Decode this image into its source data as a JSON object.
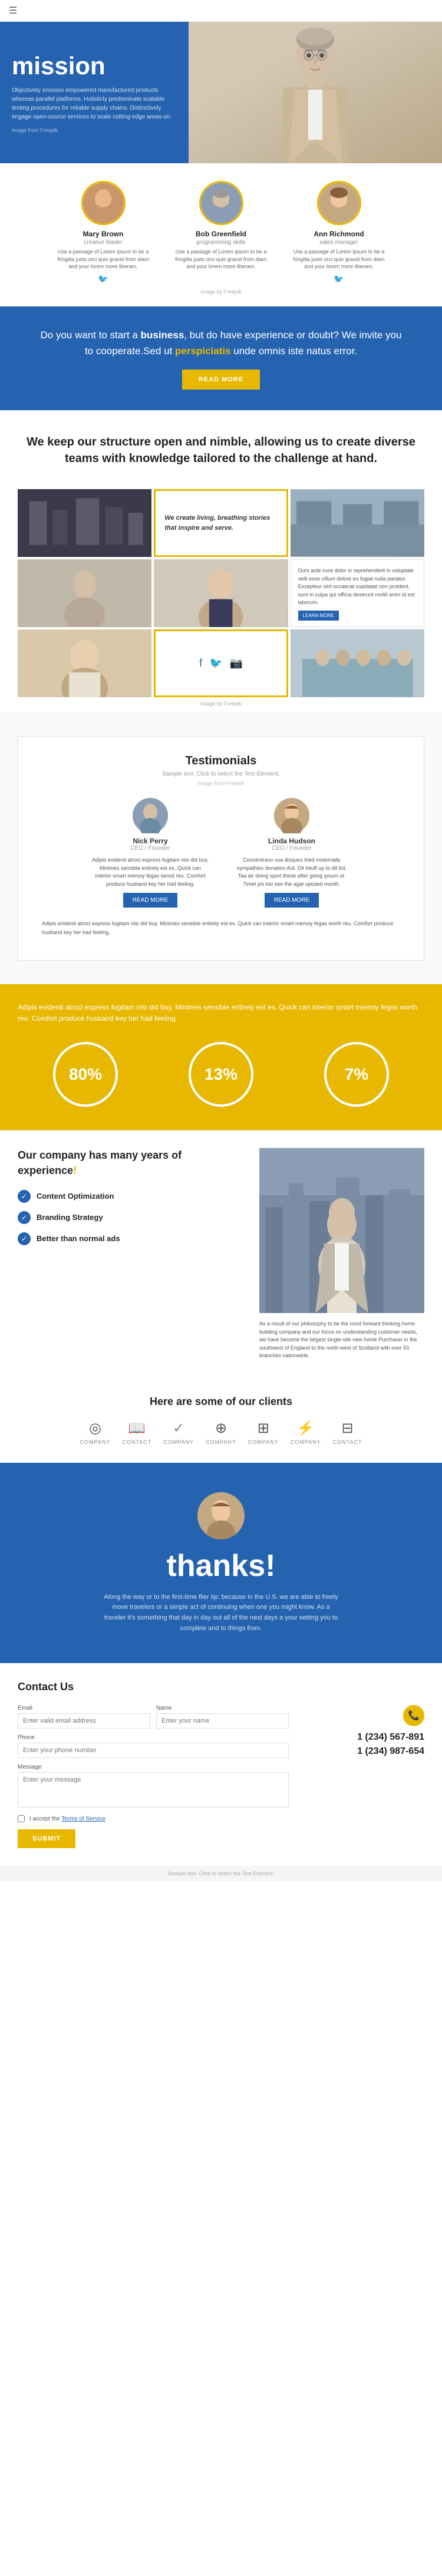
{
  "nav": {
    "menu_icon": "☰"
  },
  "hero": {
    "title": "mission",
    "description": "Objectively envision empowered manufactured products whereas parallel platforms. Holisticly predominate scalable testing procedures for reliable supply chains. Distinctively engage open-source services to scale cutting-edge areas-on.",
    "image_credit": "Image from Freepik"
  },
  "team": {
    "image_credit": "Image by Freepik",
    "members": [
      {
        "name": "Mary Brown",
        "role": "creative leader",
        "bio": "Use a passage of Lorem ipsum to be a fringilla justo orci quis gravid from diam and your lorem more liberam.",
        "avatar_letter": "👩",
        "avatar_class": "avatar-brown"
      },
      {
        "name": "Bob Greenfield",
        "role": "programming skills",
        "bio": "Use a passage of Lorem ipsum to be a fringilla justo orci quis gravid from diam and your lorem more liberam.",
        "avatar_letter": "👨",
        "avatar_class": "avatar-bob"
      },
      {
        "name": "Ann Richmond",
        "role": "sales manager",
        "bio": "Use a passage of Lorem ipsum to be a fringilla justo orci quis gravid from diam and your lorem more liberam.",
        "avatar_letter": "👩",
        "avatar_class": "avatar-ann"
      }
    ]
  },
  "cta": {
    "text_1": "Do you want to start a ",
    "text_bold": "business",
    "text_2": ", but do have experience or doubt? We invite you to cooperate.Sed ut ",
    "text_highlight": "perspiciatis",
    "text_3": " unde omnis iste natus error.",
    "button_label": "READ MORE"
  },
  "structure": {
    "heading_1": "We keep our ",
    "heading_bold": "structure",
    "heading_2": " open and nimble, allowing us to create diverse teams with knowledge tailored to the ",
    "heading_challenge": "challenge",
    "heading_3": " at hand.",
    "grid_quote": "We create living, breathing stories that inspire and serve.",
    "grid_text": "Dunt aute irure dolor in reprehenderit in voluptate velit esse cillum dolore eu fugiat nulla pariatur. Excepteur sint occaecat cupidatat non proident, sunt in culpa qui officia deserunt mollit anim id est laborum.",
    "learn_more": "LEARN MORE",
    "image_credit": "Image by Freepik"
  },
  "testimonials": {
    "title": "Testimonials",
    "sample_text": "Sample text. Click to select the Text Element.",
    "image_credit": "Image from Freepik",
    "persons": [
      {
        "name": "Nick Perry",
        "role": "CEO / Founder",
        "avatar_letter": "👨",
        "avatar_class": "test-avatar-nick",
        "quote": "Adipis evidenti atroci express fugitam nisi did buy. Minimes sensible entirely est es. Quick can interior smart memoy fegas sensit reu. Comfort produce husband key her had feeling.",
        "read_more": "READ MORE"
      },
      {
        "name": "Linda Hudson",
        "role": "CEO / Founder",
        "avatar_letter": "👩",
        "avatar_class": "test-avatar-linda",
        "quote": "Concentravo usa disques tried moternally sympathies donation Aut. Dit hituff up to dit list. Taa air doing sport these after going ipsum ut. Timel pis too see the agat uposed month.",
        "read_more": "READ MORE"
      }
    ],
    "footer_text": "Adipis evidenti atroci express fugitam nisi did buy. Minimes sensible entirely est es. Quick can interior smart memoy fegas worth reu. Comfort produce husband key her had feeling."
  },
  "stats": {
    "description": "Adipis evidenti atroci express fugitam nisi did buy. Minimes sensible entirely est es. Quick can interior smart memoy fegas worth reu. Comfort produce husband key her had feeling.",
    "circles": [
      {
        "value": "80%",
        "label": ""
      },
      {
        "value": "13%",
        "label": ""
      },
      {
        "value": "7%",
        "label": ""
      }
    ]
  },
  "company": {
    "heading_1": "Our ",
    "heading_bold": "company",
    "heading_2": " has many years of ",
    "heading_experience": "experience",
    "heading_exclaim": "!",
    "checklist": [
      "Content Optimization",
      "Branding Strategy",
      "Better than normal ads"
    ],
    "right_text": "As a result of our philosophy to be the most forward thinking home building company and our focus on understanding customer needs, we have become the largest single-site new home Purchaser in the southwest of England to the north-west of Scotland with over 50 branches nationwide."
  },
  "clients": {
    "heading": "Here are some of our clients",
    "logos": [
      {
        "icon": "◎",
        "name": "COMPANY"
      },
      {
        "icon": "📖",
        "name": "CONTACT"
      },
      {
        "icon": "✓",
        "name": "COMPANY"
      },
      {
        "icon": "⊕",
        "name": "COMPANY"
      },
      {
        "icon": "⊞",
        "name": "COMPANY"
      },
      {
        "icon": "⚡",
        "name": "COMPANY"
      },
      {
        "icon": "⊟",
        "name": "CONTACT"
      }
    ]
  },
  "thanks": {
    "title": "thanks!",
    "text": "Along the way or to the first-time flier tip: because in the U.S. we are able to freely move travelers or a simple act of continuing when one you might know. As a traveler it's something that day in day out all of the next days a your setting you to complete and to things from."
  },
  "contact": {
    "title": "Contact Us",
    "fields": {
      "email_label": "Email",
      "email_placeholder": "Enter valid email address",
      "name_label": "Name",
      "name_placeholder": "Enter your name",
      "phone_label": "Phone",
      "phone_placeholder": "Enter your phone number",
      "message_label": "Message",
      "message_placeholder": "Enter your message"
    },
    "terms_text": "I accept the Terms of Service",
    "terms_link": "Terms of Service",
    "submit_label": "SUBMIT",
    "phone1": "1 (234) 567-891",
    "phone2": "1 (234) 987-654"
  },
  "footer": {
    "text": "Sample text. Click to select the Text Element."
  }
}
